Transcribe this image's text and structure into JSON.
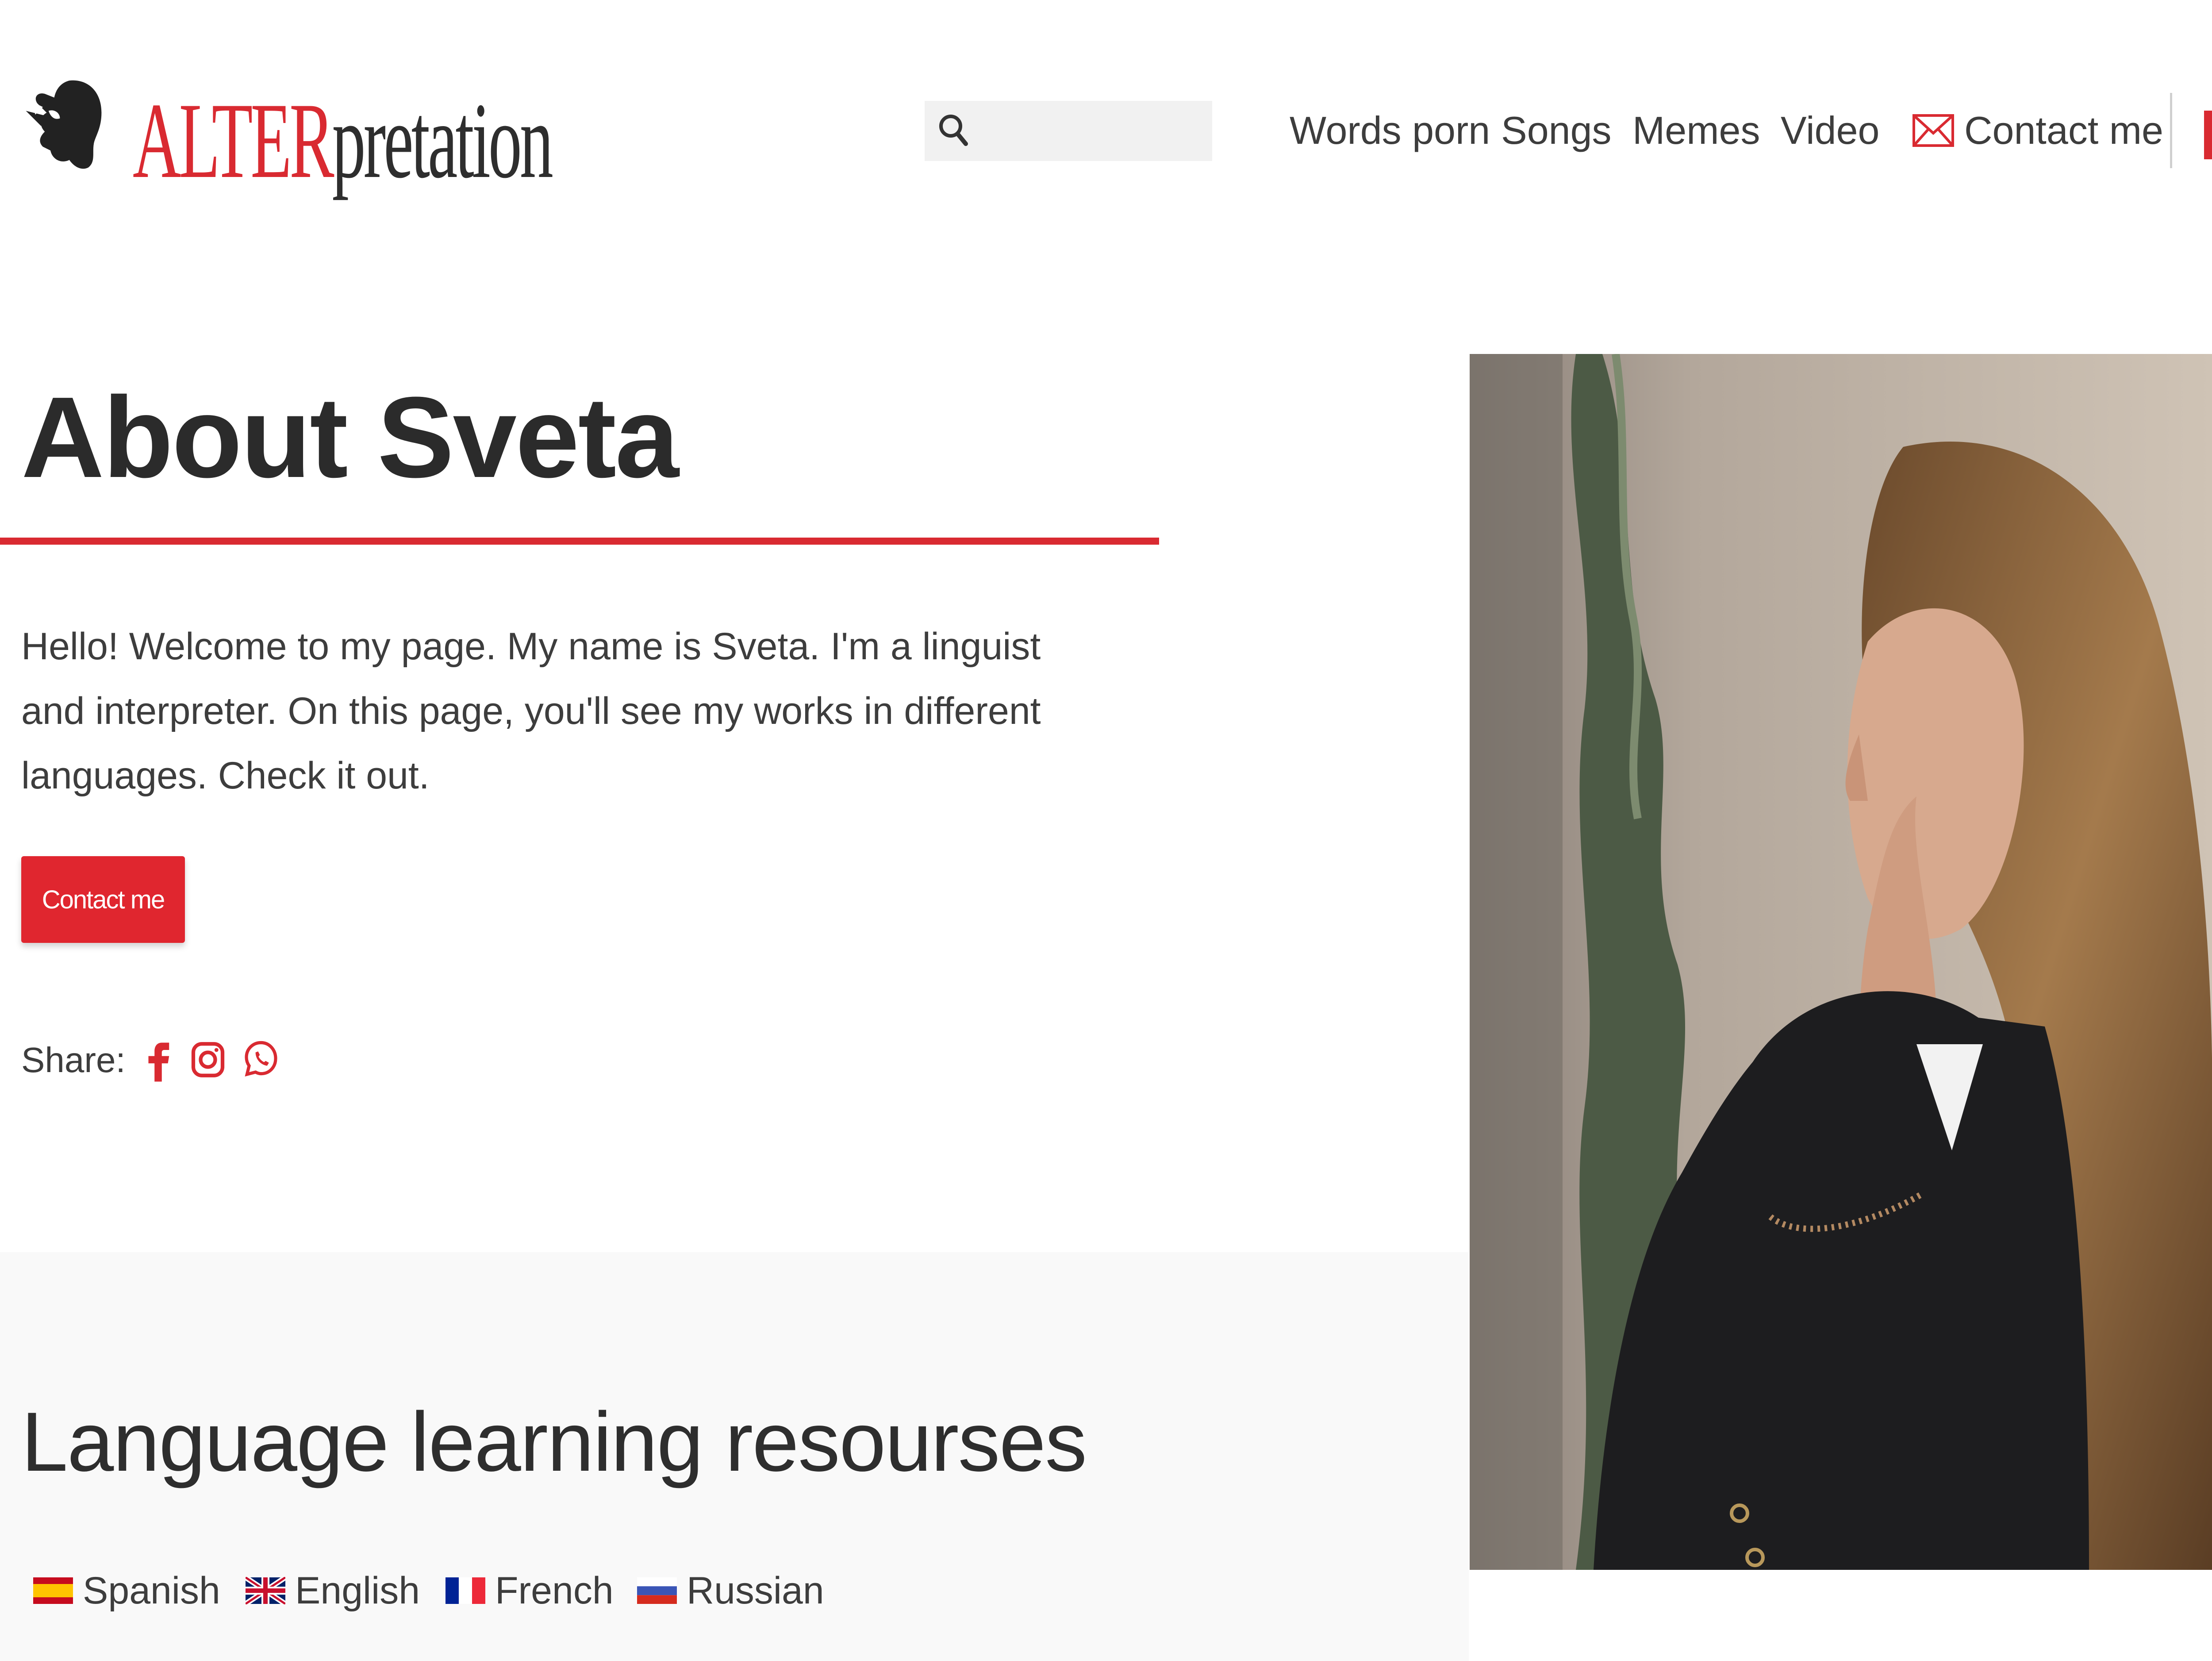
{
  "header": {
    "logo": {
      "alt_text": "ALTER",
      "pretation_text": "pretation"
    },
    "search": {
      "placeholder": "",
      "value": ""
    },
    "nav": [
      {
        "label": "Words porn"
      },
      {
        "label": "Songs"
      },
      {
        "label": "Memes"
      },
      {
        "label": "Video"
      },
      {
        "label": "Contact me",
        "icon": "mail-icon"
      }
    ]
  },
  "hero": {
    "title": "About Sveta",
    "intro": "Hello! Welcome to my page. My name is Sveta. I'm a linguist and interpreter. On this page, you'll see my works in different languages. Check it out.",
    "contact_button": "Contact me",
    "share_label": "Share:",
    "share_icons": [
      "facebook-icon",
      "instagram-icon",
      "whatsapp-icon"
    ]
  },
  "resources": {
    "title": "Language learning resourses",
    "languages": [
      {
        "label": "Spanish",
        "icon": "spain-flag-icon"
      },
      {
        "label": "English",
        "icon": "uk-flag-icon"
      },
      {
        "label": "French",
        "icon": "france-flag-icon"
      },
      {
        "label": "Russian",
        "icon": "russia-flag-icon"
      }
    ]
  },
  "colors": {
    "accent": "#d92a31",
    "text": "#333333",
    "section_background": "#f9f9f9"
  }
}
